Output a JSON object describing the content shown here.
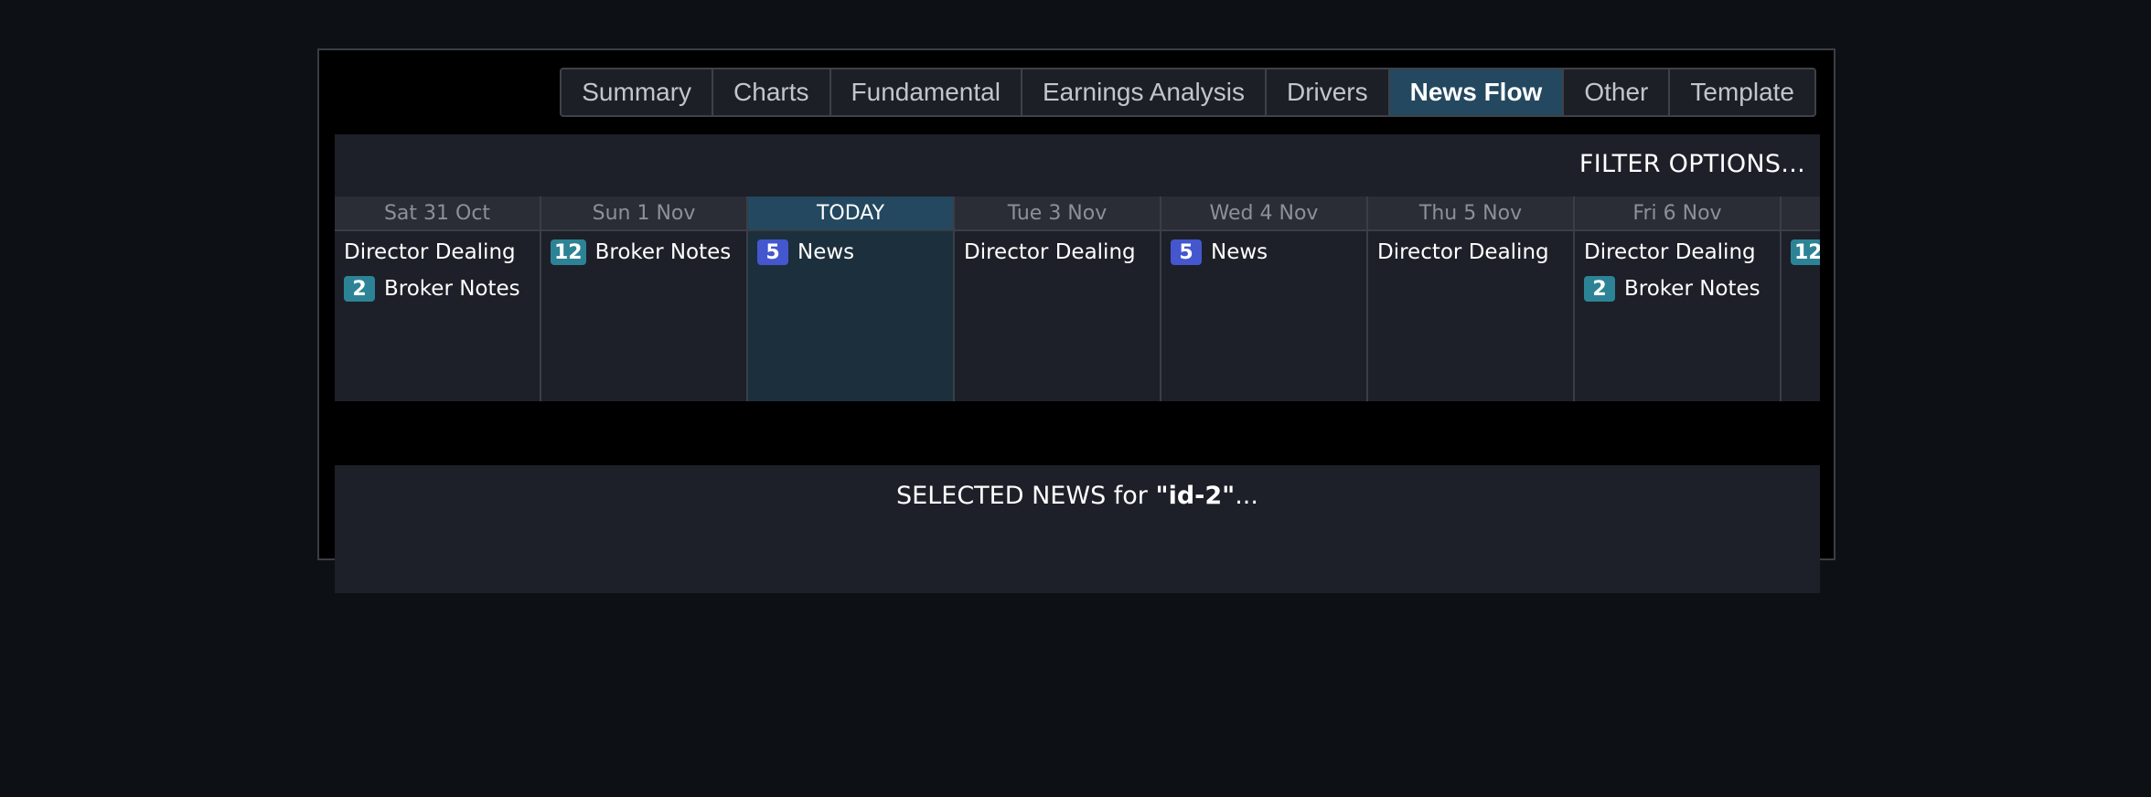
{
  "tabs": [
    {
      "label": "Summary",
      "active": false
    },
    {
      "label": "Charts",
      "active": false
    },
    {
      "label": "Fundamental",
      "active": false
    },
    {
      "label": "Earnings Analysis",
      "active": false
    },
    {
      "label": "Drivers",
      "active": false
    },
    {
      "label": "News Flow",
      "active": true
    },
    {
      "label": "Other",
      "active": false
    },
    {
      "label": "Template",
      "active": false
    }
  ],
  "filter_label": "FILTER OPTIONS...",
  "days": [
    {
      "header": "Sat 31 Oct",
      "today": false,
      "items": [
        {
          "badge": "",
          "label": "Director Dealing",
          "color": ""
        },
        {
          "badge": "2",
          "label": "Broker Notes",
          "color": "teal"
        }
      ]
    },
    {
      "header": "Sun 1 Nov",
      "today": false,
      "items": [
        {
          "badge": "12",
          "label": "Broker Notes",
          "color": "teal"
        }
      ]
    },
    {
      "header": "TODAY",
      "today": true,
      "items": [
        {
          "badge": "5",
          "label": "News",
          "color": "blue"
        }
      ]
    },
    {
      "header": "Tue 3 Nov",
      "today": false,
      "items": [
        {
          "badge": "",
          "label": "Director Dealing",
          "color": ""
        }
      ]
    },
    {
      "header": "Wed 4 Nov",
      "today": false,
      "items": [
        {
          "badge": "5",
          "label": "News",
          "color": "blue"
        }
      ]
    },
    {
      "header": "Thu 5 Nov",
      "today": false,
      "items": [
        {
          "badge": "",
          "label": "Director Dealing",
          "color": ""
        }
      ]
    },
    {
      "header": "Fri 6 Nov",
      "today": false,
      "items": [
        {
          "badge": "",
          "label": "Director Dealing",
          "color": ""
        },
        {
          "badge": "2",
          "label": "Broker Notes",
          "color": "teal"
        }
      ]
    },
    {
      "header": "",
      "today": false,
      "items": [
        {
          "badge": "12",
          "label": "",
          "color": "teal"
        }
      ]
    }
  ],
  "selected_news": {
    "prefix": "SELECTED NEWS for ",
    "id": "\"id-2\"",
    "suffix": "..."
  },
  "colors": {
    "active_tab": "#23485f",
    "teal_badge": "#2d8396",
    "blue_badge": "#4457cf",
    "panel": "#1d2028"
  }
}
